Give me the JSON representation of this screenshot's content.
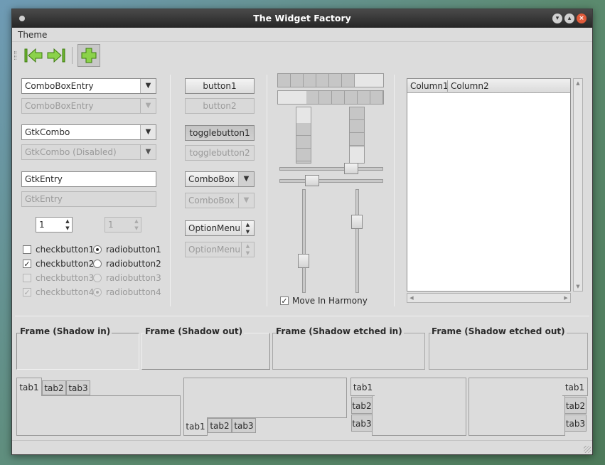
{
  "window": {
    "title": "The Widget Factory"
  },
  "menu": {
    "theme": "Theme"
  },
  "left": {
    "combo_entry": "ComboBoxEntry",
    "combo_entry_disabled": "ComboBoxEntry",
    "gtk_combo": "GtkCombo",
    "gtk_combo_disabled": "GtkCombo (Disabled)",
    "gtk_entry": "GtkEntry",
    "gtk_entry_disabled_placeholder": "GtkEntry",
    "spin_value": "1",
    "spin_disabled_value": "1",
    "checkbuttons": [
      "checkbutton1",
      "checkbutton2",
      "checkbutton3",
      "checkbutton4"
    ],
    "radiobuttons": [
      "radiobutton1",
      "radiobutton2",
      "radiobutton3",
      "radiobutton4"
    ]
  },
  "buttons": {
    "button1": "button1",
    "button2": "button2",
    "togglebutton1": "togglebutton1",
    "togglebutton2": "togglebutton2",
    "combobox": "ComboBox",
    "combobox_disabled": "ComboBox",
    "optionmenu": "OptionMenu",
    "optionmenu_disabled": "OptionMenu"
  },
  "ranges": {
    "move_in_harmony": "Move In Harmony",
    "hscale1_level": 0.67,
    "hscale2_level": 0.3,
    "vscale1_level": 0.68,
    "vscale2_level": 0.3
  },
  "tree": {
    "columns": [
      "Column1",
      "Column2"
    ]
  },
  "frames": [
    "Frame (Shadow in)",
    "Frame (Shadow out)",
    "Frame (Shadow etched in)",
    "Frame (Shadow etched out)"
  ],
  "notebooks": {
    "tabs": [
      "tab1",
      "tab2",
      "tab3"
    ]
  },
  "icons": {
    "toolbar": [
      "go-first-icon",
      "go-last-icon",
      "add-icon"
    ],
    "titlebar": [
      "minimize-icon",
      "maximize-icon",
      "close-icon"
    ]
  },
  "colors": {
    "titlebar": "#2f2f2f",
    "window_bg": "#dcdcdc",
    "close_button": "#e05a3a",
    "toolbar_icon": "#7cc43a"
  }
}
